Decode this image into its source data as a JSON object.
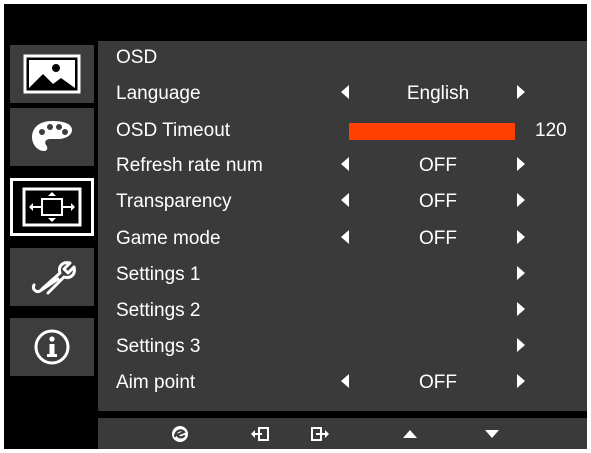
{
  "menu": {
    "title": "OSD",
    "language": {
      "label": "Language",
      "value": "English"
    },
    "osd_timeout": {
      "label": "OSD Timeout",
      "value": "120",
      "level_fraction": 1.0,
      "bar_color": "#ff4000"
    },
    "refresh_rate": {
      "label": "Refresh rate num",
      "value": "OFF"
    },
    "transparency": {
      "label": "Transparency",
      "value": "OFF"
    },
    "game_mode": {
      "label": "Game mode",
      "value": "OFF"
    },
    "settings1": {
      "label": "Settings 1"
    },
    "settings2": {
      "label": "Settings 2"
    },
    "settings3": {
      "label": "Settings 3"
    },
    "aim_point": {
      "label": "Aim point",
      "value": "OFF"
    }
  },
  "sidebar": {
    "tabs": [
      {
        "icon": "picture-icon"
      },
      {
        "icon": "palette-icon"
      },
      {
        "icon": "osd-settings-icon",
        "active": true
      },
      {
        "icon": "wrench-icon"
      },
      {
        "icon": "info-icon"
      }
    ]
  },
  "buttons": {
    "items": [
      {
        "icon": "empowering-icon"
      },
      {
        "icon": "exit-icon"
      },
      {
        "icon": "enter-icon"
      },
      {
        "icon": "up-icon"
      },
      {
        "icon": "down-icon"
      }
    ]
  },
  "colors": {
    "background": "#000000",
    "panel": "#3a3a3a",
    "tab": "#3d3d3d",
    "accent": "#ff4000",
    "text": "#ffffff"
  }
}
